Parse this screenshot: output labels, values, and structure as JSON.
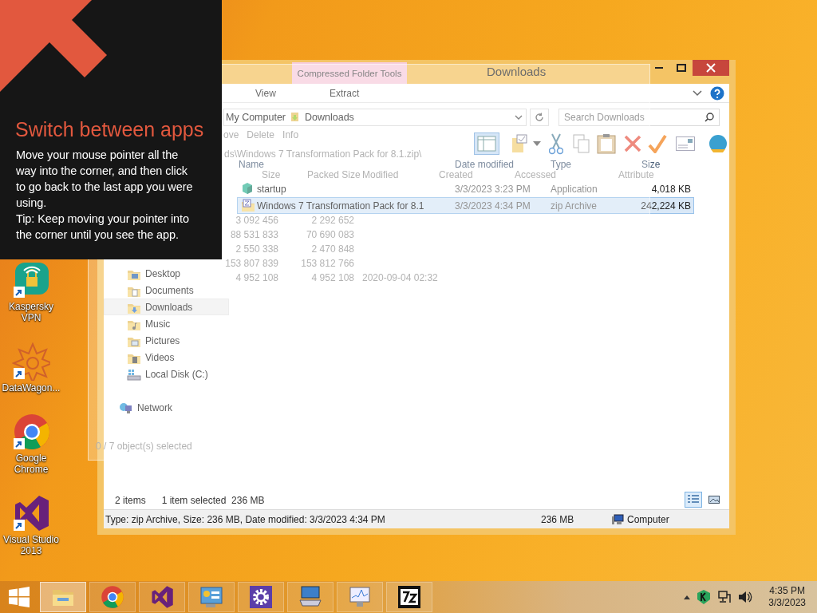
{
  "tip": {
    "title": "Switch between apps",
    "body": "Move your mouse pointer all the way into the corner, and then click to go back to the last app you were using.",
    "hint": "Tip: Keep moving your pointer into the corner until you see the app."
  },
  "desktop_icons": [
    {
      "label": "Kaspersky VPN",
      "kind": "vpn"
    },
    {
      "label": "DataWagon...",
      "kind": "mandala"
    },
    {
      "label": "Google Chrome",
      "kind": "chrome"
    },
    {
      "label": "Visual Studio 2013",
      "kind": "vs"
    }
  ],
  "explorer": {
    "title": "Downloads",
    "context_group": "Compressed Folder Tools",
    "tabs": [
      {
        "label": "View"
      },
      {
        "label": "Extract"
      }
    ],
    "address": [
      "My Computer",
      "Downloads"
    ],
    "search": {
      "placeholder": "Search Downloads"
    },
    "columns": [
      "Name",
      "Date modified",
      "Type",
      "Size"
    ],
    "files": [
      {
        "name": "startup",
        "date": "3/3/2023 3:23 PM",
        "type": "Application",
        "size": "4,018 KB",
        "kind": "app",
        "selected": false
      },
      {
        "name": "Windows 7 Transformation Pack for 8.1",
        "date": "3/3/2023 4:34 PM",
        "type": "zip Archive",
        "size": "242,224 KB",
        "kind": "zip",
        "selected": true
      }
    ],
    "nav": [
      {
        "label": "Desktop",
        "kind": "desktop",
        "selected": false
      },
      {
        "label": "Documents",
        "kind": "documents",
        "selected": false
      },
      {
        "label": "Downloads",
        "kind": "downloads",
        "selected": true
      },
      {
        "label": "Music",
        "kind": "music",
        "selected": false
      },
      {
        "label": "Pictures",
        "kind": "pictures",
        "selected": false
      },
      {
        "label": "Videos",
        "kind": "videos",
        "selected": false
      },
      {
        "label": "Local Disk (C:)",
        "kind": "disk",
        "selected": false
      },
      {
        "label": "Network",
        "kind": "network",
        "selected": false
      }
    ],
    "details": {
      "count": "2 items",
      "selection": "1 item selected",
      "size": "236 MB"
    },
    "status_bar": {
      "info": "Type: zip Archive, Size: 236 MB, Date modified: 3/3/2023 4:34 PM",
      "size": "236 MB",
      "zone": "Computer"
    }
  },
  "faded_window": {
    "toolbar": [
      "ove",
      "Delete",
      "Info"
    ],
    "path": "ds\\Windows 7 Transformation Pack for 8.1.zip\\",
    "columns": [
      "Size",
      "Packed Size",
      "Modified",
      "Created",
      "Accessed",
      "Attribute"
    ],
    "rows": [
      {
        "size": "3 092 456",
        "packed": "2 292 652"
      },
      {
        "size": "88 531 833",
        "packed": "70 690 083"
      },
      {
        "size": "2 550 338",
        "packed": "2 470 848"
      },
      {
        "size": "153 807 839",
        "packed": "153 812 766"
      },
      {
        "size": "4 952 108",
        "packed": "4 952 108",
        "modified": "2020-09-04 02:32"
      }
    ],
    "status": "0 / 7 object(s) selected"
  },
  "taskbar": {
    "apps": [
      {
        "kind": "explorer",
        "selected": true
      },
      {
        "kind": "chrome",
        "selected": false
      },
      {
        "kind": "vs",
        "selected": false
      },
      {
        "kind": "control",
        "selected": false
      },
      {
        "kind": "gear",
        "selected": false
      },
      {
        "kind": "remote",
        "selected": false
      },
      {
        "kind": "monitor",
        "selected": false
      },
      {
        "kind": "sevenzip",
        "selected": false
      }
    ],
    "time": "4:35 PM",
    "date": "3/3/2023"
  }
}
